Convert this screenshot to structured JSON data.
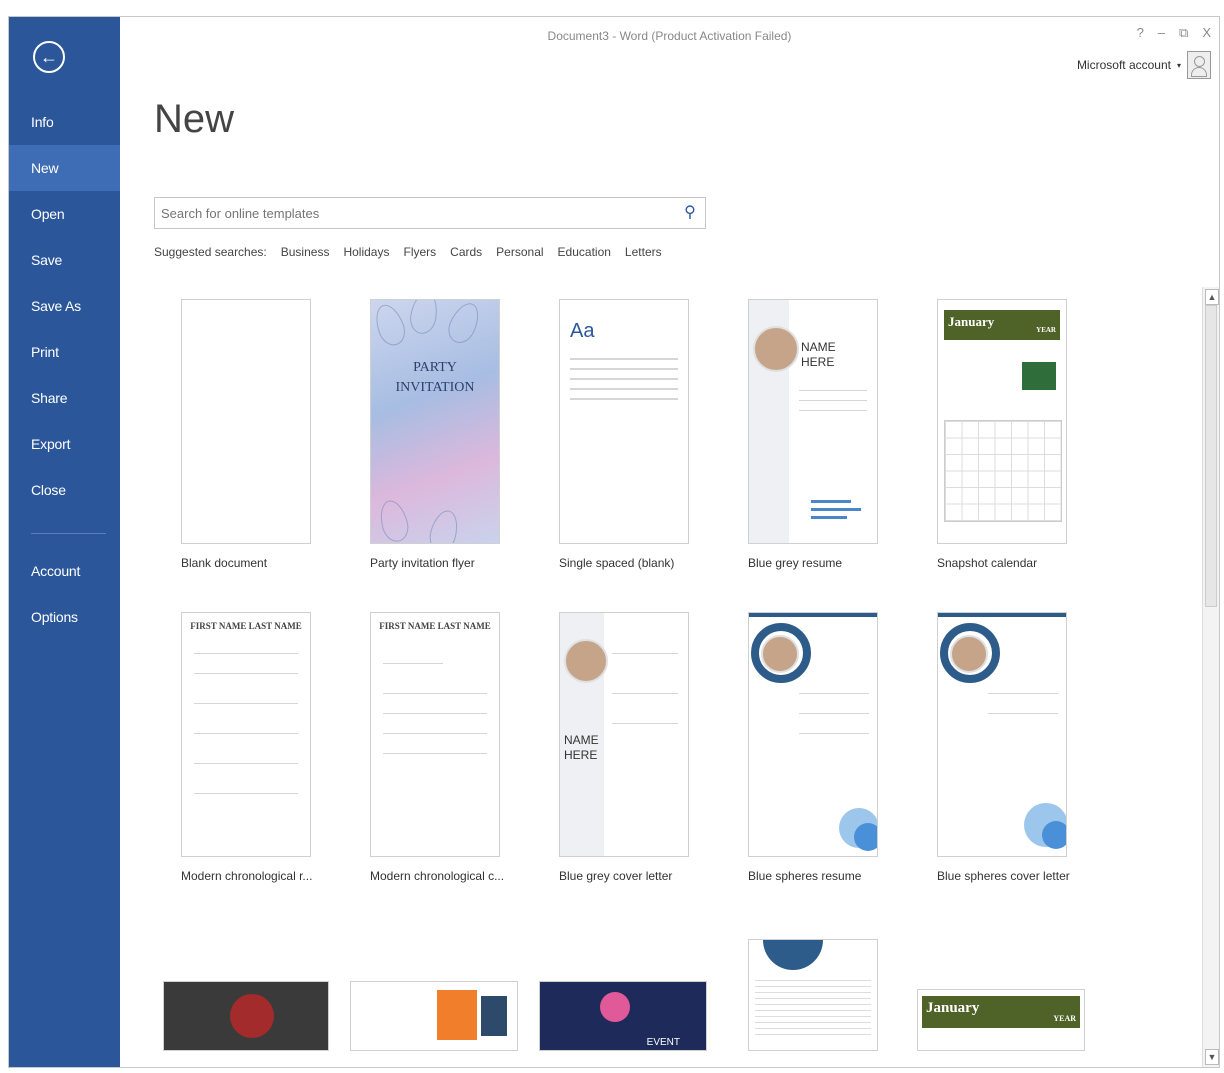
{
  "window": {
    "title": "Document3 - Word (Product Activation Failed)",
    "help": "?",
    "minimize": "–",
    "restore": "⧉",
    "close": "X",
    "account_label": "Microsoft account"
  },
  "sidebar": {
    "back_icon": "arrow-left-icon",
    "items": [
      {
        "label": "Info"
      },
      {
        "label": "New"
      },
      {
        "label": "Open"
      },
      {
        "label": "Save"
      },
      {
        "label": "Save As"
      },
      {
        "label": "Print"
      },
      {
        "label": "Share"
      },
      {
        "label": "Export"
      },
      {
        "label": "Close"
      }
    ],
    "bottom_items": [
      {
        "label": "Account"
      },
      {
        "label": "Options"
      }
    ],
    "active": "New",
    "color": "#2b579a"
  },
  "main": {
    "title": "New",
    "search": {
      "placeholder": "Search for online templates",
      "value": ""
    },
    "suggested_label": "Suggested searches:",
    "suggested": [
      "Business",
      "Holidays",
      "Flyers",
      "Cards",
      "Personal",
      "Education",
      "Letters"
    ],
    "templates": [
      {
        "label": "Blank document"
      },
      {
        "label": "Party invitation flyer",
        "title_line1": "PARTY",
        "title_line2": "INVITATION"
      },
      {
        "label": "Single spaced (blank)",
        "preview_text": "Aa"
      },
      {
        "label": "Blue grey resume",
        "name_line1": "NAME",
        "name_line2": "HERE"
      },
      {
        "label": "Snapshot calendar",
        "month": "January",
        "year": "YEAR"
      },
      {
        "label": "Modern chronological r...",
        "heading": "FIRST NAME LAST NAME"
      },
      {
        "label": "Modern chronological c...",
        "heading": "FIRST NAME LAST NAME"
      },
      {
        "label": "Blue grey cover letter",
        "name_line1": "NAME",
        "name_line2": "HERE"
      },
      {
        "label": "Blue spheres resume"
      },
      {
        "label": "Blue spheres cover letter"
      }
    ],
    "bottom_row": {
      "calendar_month": "January",
      "calendar_year": "YEAR",
      "event_text": "EVENT"
    }
  }
}
